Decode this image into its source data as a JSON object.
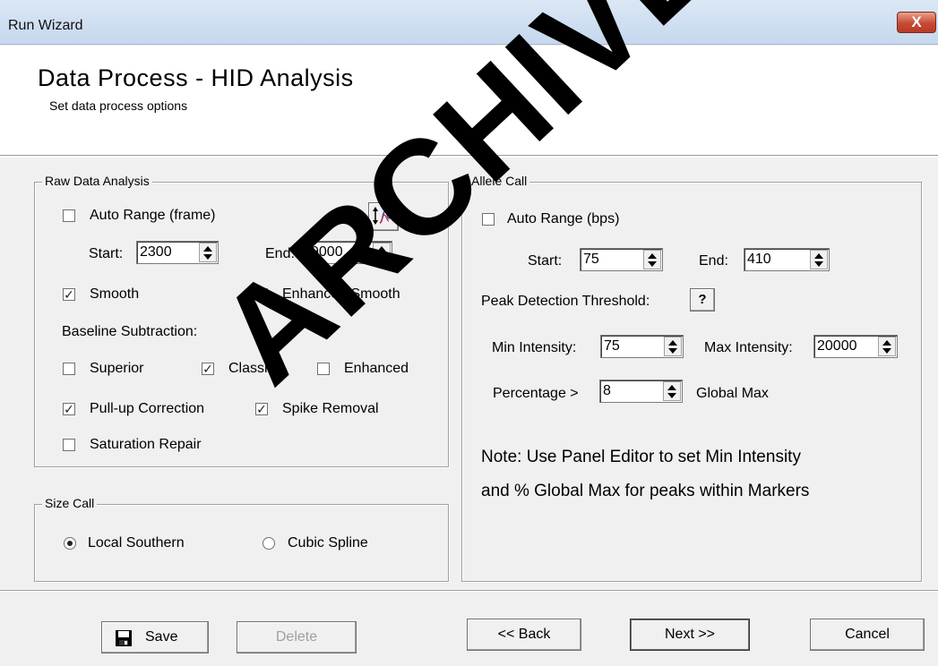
{
  "window": {
    "title": "Run Wizard",
    "close_label": "X"
  },
  "header": {
    "title": "Data Process - HID Analysis",
    "subtitle": "Set data process options"
  },
  "raw": {
    "group_title": "Raw Data Analysis",
    "auto_range_label": "Auto Range (frame)",
    "auto_range_checked": false,
    "start_label": "Start:",
    "start_value": "2300",
    "end_label": "End:",
    "end_value": "9000",
    "smooth_label": "Smooth",
    "smooth_checked": true,
    "enhanced_smooth_label": "Enhanced Smooth",
    "enhanced_smooth_checked": false,
    "baseline_label": "Baseline Subtraction:",
    "superior_label": "Superior",
    "superior_checked": false,
    "classic_label": "Classic",
    "classic_checked": true,
    "enhanced_label": "Enhanced",
    "enhanced_checked": false,
    "pullup_label": "Pull-up Correction",
    "pullup_checked": true,
    "spike_label": "Spike Removal",
    "spike_checked": true,
    "saturation_label": "Saturation Repair",
    "saturation_checked": false
  },
  "size_call": {
    "group_title": "Size Call",
    "local_southern_label": "Local Southern",
    "local_southern_selected": true,
    "cubic_spline_label": "Cubic Spline",
    "cubic_spline_selected": false
  },
  "allele": {
    "group_title": "Allele Call",
    "auto_range_label": "Auto Range (bps)",
    "auto_range_checked": false,
    "start_label": "Start:",
    "start_value": "75",
    "end_label": "End:",
    "end_value": "410",
    "peak_threshold_label": "Peak Detection Threshold:",
    "help_label": "?",
    "min_intensity_label": "Min Intensity:",
    "min_intensity_value": "75",
    "max_intensity_label": "Max Intensity:",
    "max_intensity_value": "20000",
    "percentage_label": "Percentage >",
    "percentage_value": "8",
    "global_max_label": "Global Max",
    "note_line1": "Note: Use Panel Editor to set Min Intensity",
    "note_line2": "and % Global Max for peaks within Markers"
  },
  "footer": {
    "save_label": "Save",
    "delete_label": "Delete",
    "back_label": "<< Back",
    "next_label": "Next >>",
    "cancel_label": "Cancel"
  },
  "watermark": "ARCHIVED",
  "icons": {
    "save": "floppy-disk-icon",
    "range_tool": "range-scale-icon",
    "close": "close-icon"
  }
}
